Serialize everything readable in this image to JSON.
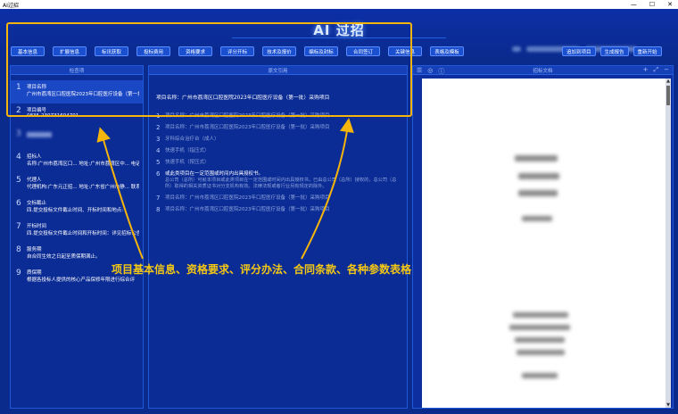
{
  "window": {
    "title": "AI过招",
    "controls": [
      "—",
      "☐",
      "✕"
    ]
  },
  "header": {
    "title": "AI 过招"
  },
  "tabs": [
    "基本信息",
    "扩展信息",
    "标讯获取",
    "投标费用",
    "资格要求",
    "评分开标",
    "技术及报价",
    "编标及封标",
    "合同签订",
    "关键信息",
    "表格及模板"
  ],
  "actions": {
    "add_project": "追加到项目",
    "generate_report": "生成报告",
    "restart": "重新开始"
  },
  "left_panel": {
    "title": "检查项",
    "items": [
      {
        "num": "1",
        "label": "项目名称",
        "value": "广州市荔湾区口腔医院2023年口腔医疗设备（第一批）"
      },
      {
        "num": "2",
        "label": "项目编号",
        "value": "0835-230Z31604701"
      },
      {
        "num": "3",
        "label": "",
        "value": ""
      },
      {
        "num": "4",
        "label": "招标人",
        "value": "名称:广州市荔湾区口... 地址:广州市荔湾区中... 电话"
      },
      {
        "num": "5",
        "label": "代理人",
        "value": "代理机构:广东元正招... 地址:广东省广州市静... 联系"
      },
      {
        "num": "6",
        "label": "交标截止",
        "value": "四.提交投标文件截止时间、开标时间和地点:"
      },
      {
        "num": "7",
        "label": "开标时间",
        "value": "四.提交投标文件截止时间和开标时间：详见招标公告"
      },
      {
        "num": "8",
        "label": "服务期",
        "value": "自合同生效之日起至质保期满止。"
      },
      {
        "num": "9",
        "label": "质保期",
        "value": "根据各投标人提供的核心产品保修年限进行综合评"
      }
    ]
  },
  "mid_panel": {
    "title": "原文引用",
    "top_line": "项目名称：广州市荔湾区口腔医院2023年口腔医疗设备（第一批）采购项目",
    "items": [
      {
        "num": "1",
        "text": "项目名称：广州市荔湾区口腔医院2023年口腔医疗设备（第一批）采购项目",
        "sub": ""
      },
      {
        "num": "2",
        "text": "项目名称：广州市荔湾区口腔医院2023年口腔医疗设备（第一批）采购项目",
        "sub": ""
      },
      {
        "num": "3",
        "text": "牙科综合治疗台（成人）",
        "sub": ""
      },
      {
        "num": "4",
        "text": "快速手机（指压式）",
        "sub": ""
      },
      {
        "num": "5",
        "text": "快速手机（按压式）",
        "sub": ""
      },
      {
        "num": "6",
        "text": "或此类项目在一定范围或时间内出具授权书。",
        "sub": "总公司（总所）可就本项目或此类项目在一定范围或时间内出具授权书，已由总公司（总所）授权的，总公司（总所）取得的相关资质证书对分支机构有效。法律法规或者行业另有规定的除外。"
      },
      {
        "num": "7",
        "text": "项目名称：广州市荔湾区口腔医院2023年口腔医疗设备（第一批）采购项目",
        "sub": ""
      },
      {
        "num": "8",
        "text": "项目名称：广州市荔湾区口腔医院2023年口腔医疗设备（第一批）采购项目",
        "sub": ""
      }
    ]
  },
  "right_panel": {
    "title": "招标文档"
  },
  "annotation": "项目基本信息、资格要求、评分办法、合同条款、各种参数表格",
  "colors": {
    "background": "#0a2a8c",
    "highlight": "#f5b50c",
    "annotation": "#f5c814"
  }
}
